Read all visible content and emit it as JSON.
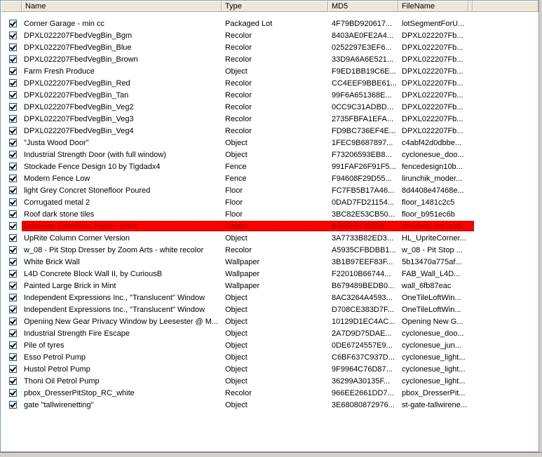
{
  "columns": {
    "name": "Name",
    "type": "Type",
    "md5": "MD5",
    "filename": "FileName"
  },
  "rows": [
    {
      "name": "Corner Garage - min cc",
      "type": "Packaged Lot",
      "md5": "4F79BD920617...",
      "file": "lotSegmentForU...",
      "checked": true
    },
    {
      "name": "DPXL022207FbedVegBin_Bgm",
      "type": "Recolor",
      "md5": "8403AE0FE2A4...",
      "file": "DPXL022207Fb...",
      "checked": true
    },
    {
      "name": "DPXL022207FbedVegBin_Blue",
      "type": "Recolor",
      "md5": "0252297E3EF6...",
      "file": "DPXL022207Fb...",
      "checked": true
    },
    {
      "name": "DPXL022207FbedVegBin_Brown",
      "type": "Recolor",
      "md5": "33D9A6A6E521...",
      "file": "DPXL022207Fb...",
      "checked": true
    },
    {
      "name": "Farm Fresh Produce",
      "type": "Object",
      "md5": "F9ED1BB19C6E...",
      "file": "DPXL022207Fb...",
      "checked": true
    },
    {
      "name": "DPXL022207FbedVegBin_Red",
      "type": "Recolor",
      "md5": "CC4EEF9BBE61...",
      "file": "DPXL022207Fb...",
      "checked": true
    },
    {
      "name": "DPXL022207FbedVegBin_Tan",
      "type": "Recolor",
      "md5": "99F6A651368E...",
      "file": "DPXL022207Fb...",
      "checked": true
    },
    {
      "name": "DPXL022207FbedVegBin_Veg2",
      "type": "Recolor",
      "md5": "0CC9C31ADBD...",
      "file": "DPXL022207Fb...",
      "checked": true
    },
    {
      "name": "DPXL022207FbedVegBin_Veg3",
      "type": "Recolor",
      "md5": "2735FBFA1EFA...",
      "file": "DPXL022207Fb...",
      "checked": true
    },
    {
      "name": "DPXL022207FbedVegBin_Veg4",
      "type": "Recolor",
      "md5": "FD9BC736EF4E...",
      "file": "DPXL022207Fb...",
      "checked": true
    },
    {
      "name": "\"Justa Wood Door\"",
      "type": "Object",
      "md5": "1FEC9B687897...",
      "file": "c4abf42d0dbbe...",
      "checked": true
    },
    {
      "name": "Industrial Strength Door (with full window)",
      "type": "Object",
      "md5": "F73206593EB8...",
      "file": "cyclonesue_doo...",
      "checked": true
    },
    {
      "name": "Stockade Fence Design 10 by Tigdadx4",
      "type": "Fence",
      "md5": "991FAF26F91F5...",
      "file": "fencedesign10b...",
      "checked": true
    },
    {
      "name": "Modern Fence Low",
      "type": "Fence",
      "md5": "F94608F29D55...",
      "file": "lirunchik_moder...",
      "checked": true
    },
    {
      "name": "light Grey Concret Stonefloor Poured",
      "type": "Floor",
      "md5": "FC7FB5B17A46...",
      "file": "8d4408e47468e...",
      "checked": true
    },
    {
      "name": "Corrugated metal 2",
      "type": "Floor",
      "md5": "0DAD7FD21154...",
      "file": "floor_1481c2c5",
      "checked": true
    },
    {
      "name": "Roof dark stone tiles",
      "type": "Floor",
      "md5": "3BC82E53CB50...",
      "file": "floor_b951ec6b",
      "checked": true
    },
    {
      "name": "Driveway Extension Piece - Brick",
      "type": "Object",
      "md5": "B465F6720006...",
      "file": "driveway ext brick",
      "checked": true,
      "selected": true
    },
    {
      "name": "UpRite Column  Corner Version",
      "type": "Object",
      "md5": "3A7733B82ED3...",
      "file": "HL_UpriteCorner...",
      "checked": true
    },
    {
      "name": "w_08 - Pit Stop Dresser by Zoom Arts  - white recolor",
      "type": "Recolor",
      "md5": "A5935CFBDBB1...",
      "file": "w_08 - Pit Stop ...",
      "checked": true
    },
    {
      "name": "White Brick Wall",
      "type": "Wallpaper",
      "md5": "3B1B97EEF83F...",
      "file": "5b13470a775af...",
      "checked": true
    },
    {
      "name": "L4D Concrete Block Wall II, by CuriousB",
      "type": "Wallpaper",
      "md5": "F22010B66744...",
      "file": "FAB_Wall_L4D...",
      "checked": true
    },
    {
      "name": "Painted Large Brick in Mint",
      "type": "Wallpaper",
      "md5": "B679489BEDB0...",
      "file": "wall_6fb87eac",
      "checked": true
    },
    {
      "name": "Independent Expressions Inc., \"Translucent\" Window",
      "type": "Object",
      "md5": "8AC3264A4593...",
      "file": "OneTileLoftWin...",
      "checked": true
    },
    {
      "name": "Independent Expressions Inc., \"Translucent\" Window",
      "type": "Object",
      "md5": "D708CE383D7F...",
      "file": "OneTileLoftWin...",
      "checked": true
    },
    {
      "name": "Opening New Gear Privacy Window by Leesester @ M...",
      "type": "Object",
      "md5": "10129D1EC4AC...",
      "file": "Opening New G...",
      "checked": true
    },
    {
      "name": "Industrial Strength Fire Escape",
      "type": "Object",
      "md5": "2A7D9D75DAE...",
      "file": "cyclonesue_doo...",
      "checked": true
    },
    {
      "name": "Pile of tyres",
      "type": "Object",
      "md5": "0DE6724557E9...",
      "file": "cyclonesue_jun...",
      "checked": true
    },
    {
      "name": "Esso Petrol Pump",
      "type": "Object",
      "md5": "C6BF637C937D...",
      "file": "cyclonesue_light...",
      "checked": true
    },
    {
      "name": "Hustol Petrol Pump",
      "type": "Object",
      "md5": "9F9964C76D87...",
      "file": "cyclonesue_light...",
      "checked": true
    },
    {
      "name": "Thoni Oil Petrol Pump",
      "type": "Object",
      "md5": "36299A30135F...",
      "file": "cyclonesue_light...",
      "checked": true
    },
    {
      "name": "pbox_DresserPitStop_RC_white",
      "type": "Recolor",
      "md5": "966EE2661DD7...",
      "file": "pbox_DresserPit...",
      "checked": true
    },
    {
      "name": "gate \"tallwirenetting\"",
      "type": "Object",
      "md5": "3E68080872976...",
      "file": "st-gate-tallwirene...",
      "checked": true
    }
  ]
}
